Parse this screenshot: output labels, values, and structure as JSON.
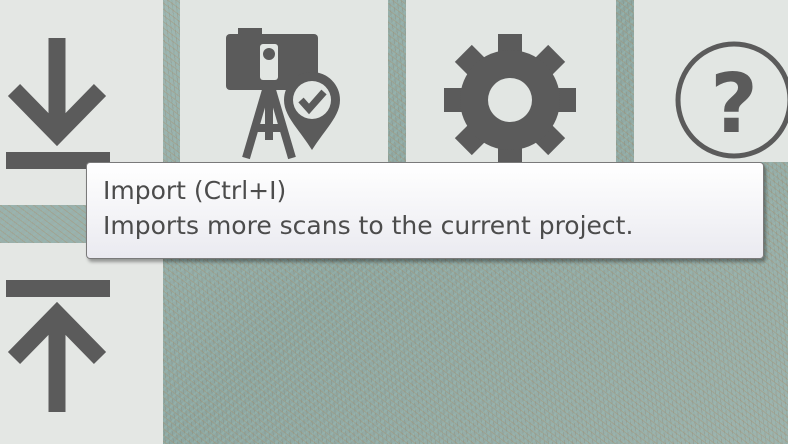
{
  "toolbar": {
    "buttons": [
      {
        "id": "import",
        "icon": "import-icon"
      },
      {
        "id": "scan-location",
        "icon": "camera-location-icon"
      },
      {
        "id": "settings",
        "icon": "gear-icon"
      },
      {
        "id": "help",
        "icon": "help-icon"
      }
    ],
    "help_glyph": "?",
    "icon_color": "#5b5b5b"
  },
  "tooltip": {
    "title": "Import (Ctrl+I)",
    "description": "Imports more scans to the current project."
  }
}
